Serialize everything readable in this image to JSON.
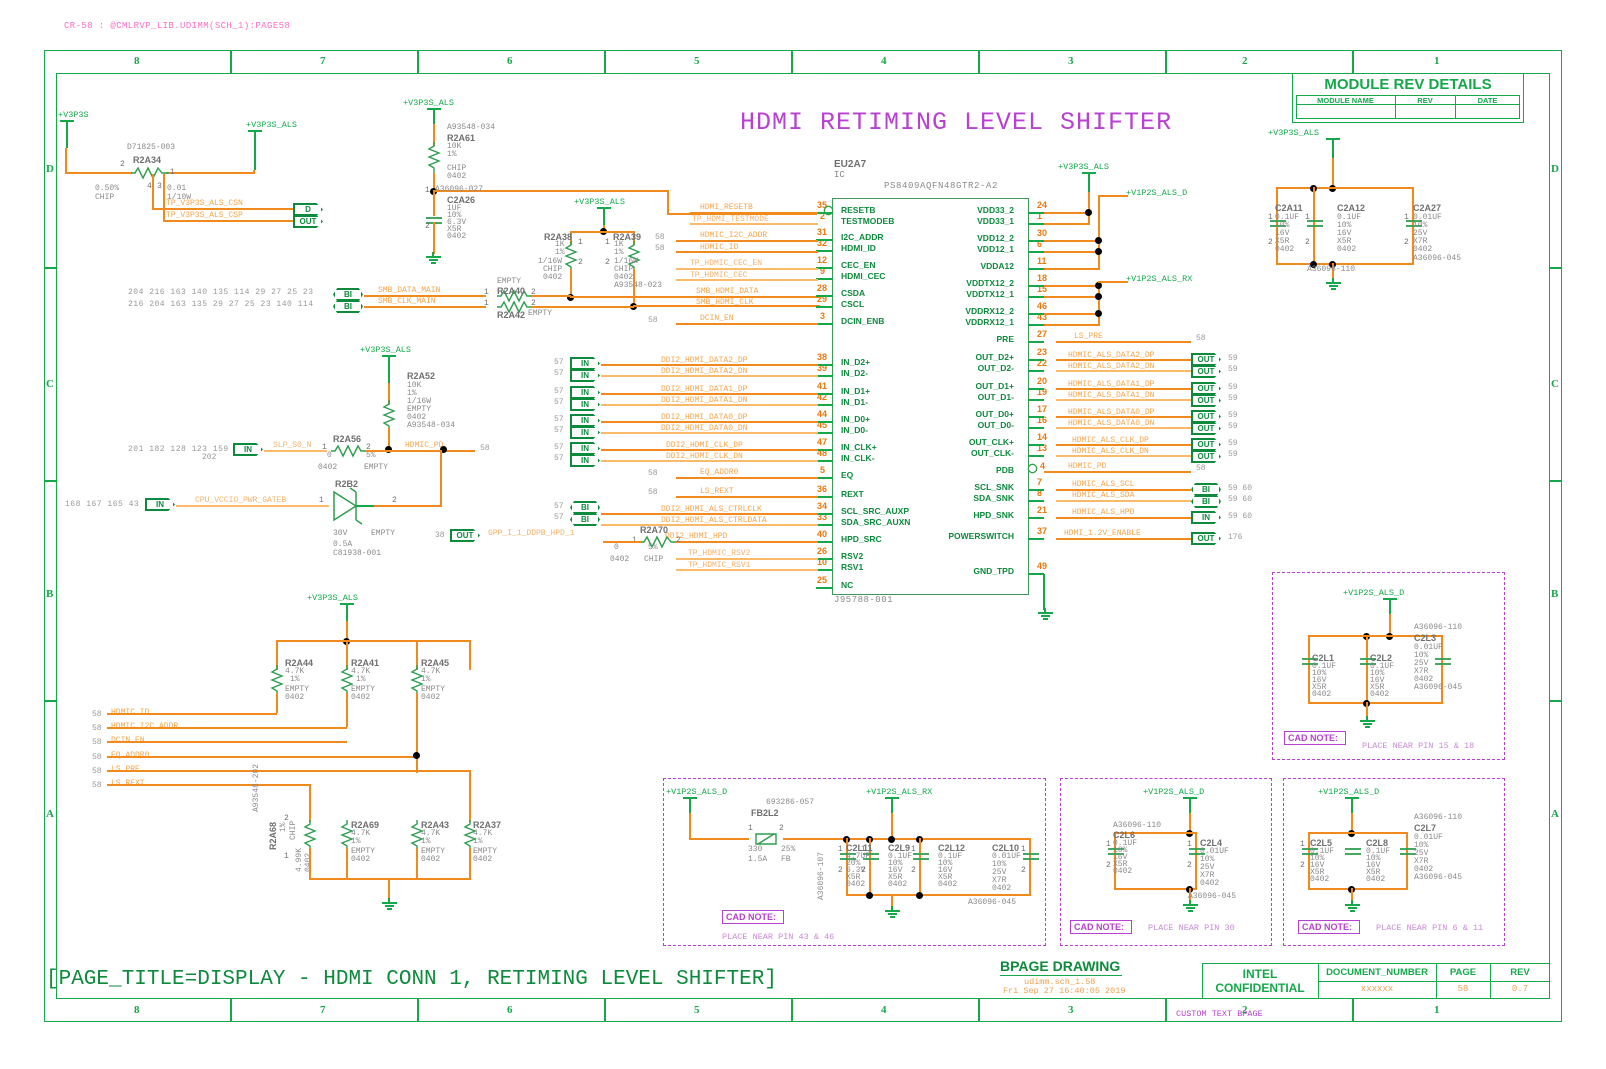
{
  "header": {
    "breadcrumb": "CR-58 : @CMLRVP_LIB.UDIMM(SCH_1):PAGE58",
    "main_title": "HDMI RETIMING LEVEL SHIFTER",
    "page_title_bottom": "[PAGE_TITLE=DISPLAY - HDMI CONN 1, RETIMING LEVEL SHIFTER]"
  },
  "zones": {
    "columns": [
      "8",
      "7",
      "6",
      "5",
      "4",
      "3",
      "2",
      "1"
    ],
    "rows": [
      "D",
      "C",
      "B",
      "A"
    ]
  },
  "module_rev": {
    "title": "MODULE REV DETAILS",
    "headers": [
      "MODULE NAME",
      "REV",
      "DATE"
    ],
    "values": [
      "",
      "",
      ""
    ]
  },
  "title_block": {
    "drawing_label": "BPAGE DRAWING",
    "file": "udimm.sch_1.58",
    "date": "Fri Sep 27 16:40:05 2019",
    "company_line1": "INTEL",
    "company_line2": "CONFIDENTIAL",
    "doc_label": "DOCUMENT_NUMBER",
    "doc_value": "xxxxxx",
    "page_label": "PAGE",
    "page_value": "58",
    "rev_label": "REV",
    "rev_value": "0.7",
    "custom_text": "CUSTOM TEXT BPAGE"
  },
  "ic": {
    "refdes": "EU2A7",
    "type": "IC",
    "part": "PS8409AQFN48GTR2-A2",
    "footprint": "J95788-001",
    "left_pins": [
      {
        "num": "35",
        "name": "RESETB",
        "bubble": true
      },
      {
        "num": "2",
        "name": "TESTMODEB"
      },
      {
        "num": "31",
        "name": "I2C_ADDR"
      },
      {
        "num": "32",
        "name": "HDMI_ID"
      },
      {
        "num": "12",
        "name": "CEC_EN"
      },
      {
        "num": "9",
        "name": "HDMI_CEC"
      },
      {
        "num": "28",
        "name": "CSDA"
      },
      {
        "num": "29",
        "name": "CSCL"
      },
      {
        "num": "3",
        "name": "DCIN_ENB"
      },
      {
        "num": "38",
        "name": "IN_D2+"
      },
      {
        "num": "39",
        "name": "IN_D2-"
      },
      {
        "num": "41",
        "name": "IN_D1+"
      },
      {
        "num": "42",
        "name": "IN_D1-"
      },
      {
        "num": "44",
        "name": "IN_D0+"
      },
      {
        "num": "45",
        "name": "IN_D0-"
      },
      {
        "num": "47",
        "name": "IN_CLK+"
      },
      {
        "num": "48",
        "name": "IN_CLK-"
      },
      {
        "num": "5",
        "name": "EQ"
      },
      {
        "num": "36",
        "name": "REXT"
      },
      {
        "num": "34",
        "name": "SCL_SRC_AUXP"
      },
      {
        "num": "33",
        "name": "SDA_SRC_AUXN"
      },
      {
        "num": "40",
        "name": "HPD_SRC"
      },
      {
        "num": "26",
        "name": "RSV2"
      },
      {
        "num": "10",
        "name": "RSV1"
      },
      {
        "num": "25",
        "name": "NC"
      }
    ],
    "right_pins": [
      {
        "num": "24",
        "name": "VDD33_2"
      },
      {
        "num": "1",
        "name": "VDD33_1"
      },
      {
        "num": "30",
        "name": "VDD12_2"
      },
      {
        "num": "6",
        "name": "VDD12_1"
      },
      {
        "num": "11",
        "name": "VDDA12"
      },
      {
        "num": "18",
        "name": "VDDTX12_2"
      },
      {
        "num": "15",
        "name": "VDDTX12_1"
      },
      {
        "num": "46",
        "name": "VDDRX12_2"
      },
      {
        "num": "43",
        "name": "VDDRX12_1"
      },
      {
        "num": "27",
        "name": "PRE"
      },
      {
        "num": "23",
        "name": "OUT_D2+"
      },
      {
        "num": "22",
        "name": "OUT_D2-"
      },
      {
        "num": "20",
        "name": "OUT_D1+"
      },
      {
        "num": "19",
        "name": "OUT_D1-"
      },
      {
        "num": "17",
        "name": "OUT_D0+"
      },
      {
        "num": "16",
        "name": "OUT_D0-"
      },
      {
        "num": "14",
        "name": "OUT_CLK+"
      },
      {
        "num": "13",
        "name": "OUT_CLK-"
      },
      {
        "num": "4",
        "name": "PDB",
        "bubble": true
      },
      {
        "num": "7",
        "name": "SCL_SNK"
      },
      {
        "num": "8",
        "name": "SDA_SNK"
      },
      {
        "num": "21",
        "name": "HPD_SNK"
      },
      {
        "num": "37",
        "name": "POWERSWITCH"
      },
      {
        "num": "49",
        "name": "GND_TPD"
      }
    ]
  },
  "nets_left": [
    {
      "label": "HDMI_RESETB",
      "page": ""
    },
    {
      "label": "TP_HDMI_TESTMODE",
      "page": ""
    },
    {
      "label": "HDMIC_I2C_ADDR",
      "page": "58"
    },
    {
      "label": "HDMIC_ID",
      "page": "58"
    },
    {
      "label": "TP_HDMIC_CEC_EN",
      "page": ""
    },
    {
      "label": "TP_HDMIC_CEC",
      "page": ""
    },
    {
      "label": "SMB_HDMI_DATA",
      "page": ""
    },
    {
      "label": "SMB_HDMI_CLK",
      "page": ""
    },
    {
      "label": "DCIN_EN",
      "page": "58"
    },
    {
      "label": "DDI2_HDMI_DATA2_DP",
      "page": "57"
    },
    {
      "label": "DDI2_HDMI_DATA2_DN",
      "page": "57"
    },
    {
      "label": "DDI2_HDMI_DATA1_DP",
      "page": "57"
    },
    {
      "label": "DDI2_HDMI_DATA1_DN",
      "page": "57"
    },
    {
      "label": "DDI2_HDMI_DATA0_DP",
      "page": "57"
    },
    {
      "label": "DDI2_HDMI_DATA0_DN",
      "page": "57"
    },
    {
      "label": "DDI2_HDMI_CLK_DP",
      "page": "57"
    },
    {
      "label": "DDI2_HDMI_CLK_DN",
      "page": "57"
    },
    {
      "label": "EQ_ADDR0",
      "page": "58"
    },
    {
      "label": "LS_REXT",
      "page": "58"
    },
    {
      "label": "DDI2_HDMI_ALS_CTRLCLK",
      "page": "57"
    },
    {
      "label": "DDI2_HDMI_ALS_CTRLDATA",
      "page": "57"
    },
    {
      "label": "DDI2_HDMI_HPD",
      "page": ""
    },
    {
      "label": "TP_HDMIC_RSV2",
      "page": ""
    },
    {
      "label": "TP_HDMIC_RSV1",
      "page": ""
    }
  ],
  "nets_right": [
    {
      "label": "LS_PRE",
      "page": "58"
    },
    {
      "label": "HDMIC_ALS_DATA2_DP",
      "page": "59"
    },
    {
      "label": "HDMIC_ALS_DATA2_DN",
      "page": "59"
    },
    {
      "label": "HDMIC_ALS_DATA1_DP",
      "page": "59"
    },
    {
      "label": "HDMIC_ALS_DATA1_DN",
      "page": "59"
    },
    {
      "label": "HDMIC_ALS_DATA0_DP",
      "page": "59"
    },
    {
      "label": "HDMIC_ALS_DATA0_DN",
      "page": "59"
    },
    {
      "label": "HDMIC_ALS_CLK_DP",
      "page": "59"
    },
    {
      "label": "HDMIC_ALS_CLK_DN",
      "page": "59"
    },
    {
      "label": "HDMIC_PD",
      "page": "58"
    },
    {
      "label": "HDMIC_ALS_SCL",
      "page": "59 60"
    },
    {
      "label": "HDMIC_ALS_SDA",
      "page": "59 60"
    },
    {
      "label": "HDMIC_ALS_HPD",
      "page": "59 60"
    },
    {
      "label": "HDMI_1.2V_ENABLE",
      "page": "176"
    }
  ],
  "bus_left": {
    "row1_pages": "204  216  163  140  135  114   29   27   25   23",
    "row2_pages": "216  204  163  135   29   27   25   23  140  114",
    "row1_label": "SMB_DATA_MAIN",
    "row2_label": "SMB_CLK_MAIN"
  },
  "components": {
    "R2A34": {
      "ref": "R2A34",
      "pn": "D71825-003",
      "lines": [
        "0.50%",
        "CHIP",
        "0.01",
        "1/10W"
      ],
      "pins": [
        "1",
        "2",
        "3",
        "4"
      ]
    },
    "R2A61": {
      "ref": "R2A61",
      "pn": "A93548-034",
      "lines": [
        "10K",
        "1%",
        "",
        "CHIP",
        "0402"
      ]
    },
    "C2A26": {
      "ref": "C2A26",
      "pn": "A36096-027",
      "lines": [
        "1UF",
        "10%",
        "6.3V",
        "X5R",
        "0402"
      ]
    },
    "R2A38": {
      "ref": "R2A38",
      "lines": [
        "1K",
        "1%",
        "1/16W",
        "CHIP",
        "0402"
      ]
    },
    "R2A39": {
      "ref": "R2A39",
      "pn": "A93548-023",
      "lines": [
        "1K",
        "1%",
        "1/16W",
        "CHIP",
        "0402"
      ]
    },
    "R2A40": {
      "ref": "R2A40",
      "lines": [
        "EMPTY"
      ]
    },
    "R2A42": {
      "ref": "R2A42",
      "lines": [
        "EMPTY"
      ]
    },
    "R2A52": {
      "ref": "R2A52",
      "pn": "A93548-034",
      "lines": [
        "10K",
        "1%",
        "1/16W",
        "EMPTY",
        "0402"
      ]
    },
    "R2A56": {
      "ref": "R2A56",
      "lines": [
        "0",
        "0402",
        "5%",
        "EMPTY"
      ]
    },
    "R2B2": {
      "ref": "R2B2",
      "pn": "C81938-001",
      "lines": [
        "30V",
        "0.5A",
        "EMPTY"
      ]
    },
    "R2A70": {
      "ref": "R2A70",
      "lines": [
        "0",
        "0402",
        "5%",
        "CHIP"
      ]
    },
    "R2A44": {
      "ref": "R2A44",
      "lines": [
        "4.7K",
        "1%",
        "EMPTY",
        "0402"
      ]
    },
    "R2A41": {
      "ref": "R2A41",
      "lines": [
        "4.7K",
        "1%",
        "EMPTY",
        "0402"
      ]
    },
    "R2A45": {
      "ref": "R2A45",
      "lines": [
        "4.7K",
        "1%",
        "EMPTY",
        "0402"
      ]
    },
    "R2A69": {
      "ref": "R2A69",
      "lines": [
        "4.7K",
        "1%",
        "EMPTY",
        "0402"
      ]
    },
    "R2A43": {
      "ref": "R2A43",
      "lines": [
        "4.7K",
        "1%",
        "EMPTY",
        "0402"
      ]
    },
    "R2A37": {
      "ref": "R2A37",
      "lines": [
        "4.7K",
        "1%",
        "EMPTY",
        "0402"
      ]
    },
    "R2A68": {
      "ref": "R2A68",
      "pn": "A93548-202",
      "lines": [
        "4.99K",
        "1%",
        "CHIP",
        "0402"
      ]
    },
    "C2A11": {
      "ref": "C2A11",
      "lines": [
        "0.1UF",
        "10%",
        "16V",
        "X5R",
        "0402"
      ]
    },
    "C2A12": {
      "ref": "C2A12",
      "lines": [
        "0.1UF",
        "10%",
        "16V",
        "X5R",
        "0402"
      ]
    },
    "C2A27": {
      "ref": "C2A27",
      "pn": "A36096-045",
      "lines": [
        "0.01UF",
        "10%",
        "25V",
        "X7R",
        "0402"
      ]
    },
    "C2L1": {
      "ref": "C2L1",
      "lines": [
        "0.1UF",
        "10%",
        "16V",
        "X5R",
        "0402"
      ]
    },
    "C2L2": {
      "ref": "C2L2",
      "lines": [
        "0.1UF",
        "10%",
        "16V",
        "X5R",
        "0402"
      ]
    },
    "C2L3": {
      "ref": "C2L3",
      "pn": "A36096-110",
      "lines": [
        "0.01UF",
        "10%",
        "25V",
        "X7R",
        "0402",
        "A36096-045"
      ]
    },
    "FB2L2": {
      "ref": "FB2L2",
      "pn": "693286-057",
      "lines": [
        "330",
        "25%",
        "1.5A",
        "FB"
      ]
    },
    "C2L11": {
      "ref": "C2L11",
      "pn": "A36096-107",
      "lines": [
        "4.7UF",
        "20%",
        "6.3V",
        "X5R",
        "0402"
      ]
    },
    "C2L9": {
      "ref": "C2L9",
      "lines": [
        "0.1UF",
        "10%",
        "16V",
        "X5R",
        "0402"
      ]
    },
    "C2L12": {
      "ref": "C2L12",
      "lines": [
        "0.1UF",
        "10%",
        "16V",
        "X5R",
        "0402"
      ]
    },
    "C2L10": {
      "ref": "C2L10",
      "pn": "A36096-045",
      "lines": [
        "0.01UF",
        "10%",
        "25V",
        "X7R",
        "0402"
      ]
    },
    "C2L6": {
      "ref": "C2L6",
      "pn": "A36096-110",
      "lines": [
        "0.1UF",
        "10%",
        "16V",
        "X5R",
        "0402"
      ]
    },
    "C2L4": {
      "ref": "C2L4",
      "pn": "A36096-045",
      "lines": [
        "0.01UF",
        "10%",
        "25V",
        "X7R",
        "0402"
      ]
    },
    "C2L5": {
      "ref": "C2L5",
      "lines": [
        "0.1UF",
        "10%",
        "16V",
        "X5R",
        "0402"
      ]
    },
    "C2L8": {
      "ref": "C2L8",
      "lines": [
        "0.1UF",
        "10%",
        "16V",
        "X5R",
        "0402"
      ]
    },
    "C2L7": {
      "ref": "C2L7",
      "pn": "A36096-110",
      "lines": [
        "0.01UF",
        "10%",
        "25V",
        "X7R",
        "0402",
        "A36096-045"
      ]
    }
  },
  "power_nets": {
    "v3p3s": "+V3P3S",
    "v3p3s_als": "+V3P3S_ALS",
    "v1p2s_als_d": "+V1P2S_ALS_D",
    "v1p2s_als_rx": "+V1P2S_ALS_RX"
  },
  "test_points": {
    "csn": "TP_V3P3S_ALS_CSN",
    "csp": "TP_V3P3S_ALS_CSP"
  },
  "misc_nets": {
    "slp_s0_n": "SLP_S0_N",
    "slp_s0_n_pages": "201  182  128  123  159   49   43",
    "slp_s0_n_pages2": "202",
    "cpu_vccio": "CPU_VCCIO_PWR_GATEB",
    "cpu_vccio_pages": "168  167  165   43",
    "gpp_hpd": "GPP_I_1_DDPB_HPD_1",
    "gpp_hpd_page": "38",
    "hdmic_pd_right_page": "58"
  },
  "pulldown_nets": [
    {
      "label": "HDMIC_ID",
      "page": "58"
    },
    {
      "label": "HDMIC_I2C_ADDR",
      "page": "58"
    },
    {
      "label": "DCIN_EN",
      "page": "58"
    },
    {
      "label": "EQ_ADDR0",
      "page": "58"
    },
    {
      "label": "LS_PRE",
      "page": "58"
    },
    {
      "label": "LS_REXT",
      "page": "58"
    }
  ],
  "cad_notes": [
    {
      "label": "CAD NOTE:",
      "text": "PLACE NEAR PIN 43 & 46"
    },
    {
      "label": "CAD NOTE:",
      "text": "PLACE NEAR PIN 30"
    },
    {
      "label": "CAD NOTE:",
      "text": "PLACE NEAR PIN 6 & 11"
    },
    {
      "label": "CAD NOTE:",
      "text": "PLACE NEAR PIN 15 & 18"
    }
  ],
  "amp_labels": {
    "a36096_110_top": "A36096-110",
    "a36096_045_top": "A36096-045",
    "a36096_045_mid": "A36096-045"
  }
}
